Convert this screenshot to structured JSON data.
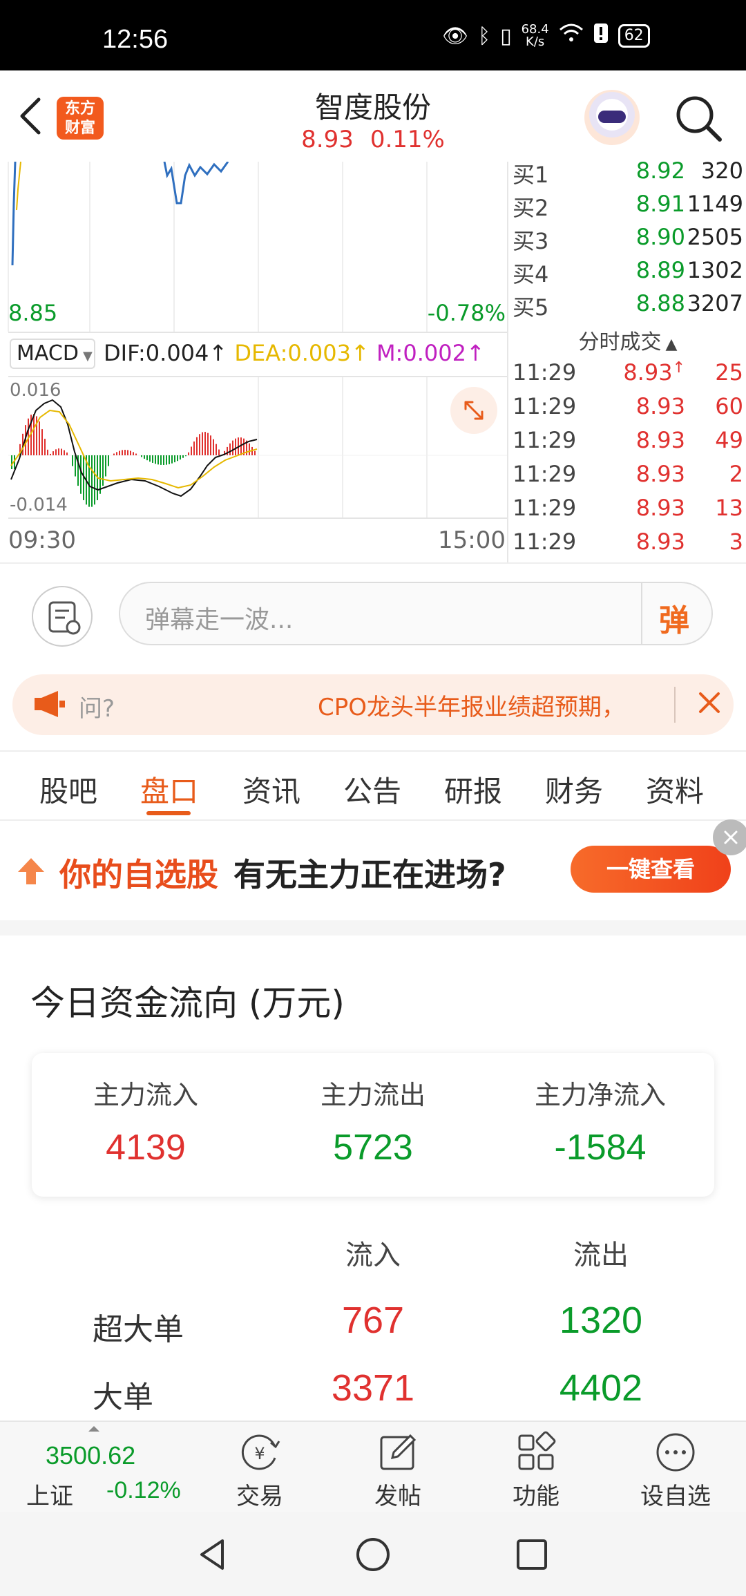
{
  "status_bar": {
    "time": "12:56",
    "net_speed_value": "68.4",
    "net_speed_unit": "K/s",
    "battery": "62",
    "icons": [
      "eye-icon",
      "bluetooth-icon",
      "vibrate-icon",
      "wifi-icon",
      "warning-icon",
      "battery-icon"
    ]
  },
  "header": {
    "logo_line1": "东方",
    "logo_line2": "财富",
    "title": "智度股份",
    "price": "8.93",
    "change_pct": "0.11%"
  },
  "chart": {
    "price_low_label": "8.85",
    "pct_low_label": "-0.78%",
    "indicator": "MACD",
    "dif": "DIF:0.004",
    "dea": "DEA:0.003",
    "m": "M:0.002",
    "macd_top": "0.016",
    "macd_bottom": "-0.014",
    "time_start": "09:30",
    "time_end": "15:00"
  },
  "order_book": {
    "bids": [
      {
        "label": "买1",
        "price": "8.92",
        "volume": "320"
      },
      {
        "label": "买2",
        "price": "8.91",
        "volume": "1149"
      },
      {
        "label": "买3",
        "price": "8.90",
        "volume": "2505"
      },
      {
        "label": "买4",
        "price": "8.89",
        "volume": "1302"
      },
      {
        "label": "买5",
        "price": "8.88",
        "volume": "3207"
      }
    ],
    "ticks_title": "分时成交",
    "ticks": [
      {
        "time": "11:29",
        "price": "8.93",
        "arrow": "↑",
        "volume": "25"
      },
      {
        "time": "11:29",
        "price": "8.93",
        "arrow": "",
        "volume": "60"
      },
      {
        "time": "11:29",
        "price": "8.93",
        "arrow": "",
        "volume": "49"
      },
      {
        "time": "11:29",
        "price": "8.93",
        "arrow": "",
        "volume": "2"
      },
      {
        "time": "11:29",
        "price": "8.93",
        "arrow": "",
        "volume": "13"
      },
      {
        "time": "11:29",
        "price": "8.93",
        "arrow": "",
        "volume": "3"
      }
    ]
  },
  "comment": {
    "placeholder": "弹幕走一波...",
    "danmu_label": "弹"
  },
  "news": {
    "question": "问?",
    "headline": "CPO龙头半年报业绩超预期，"
  },
  "tabs": [
    "股吧",
    "盘口",
    "资讯",
    "公告",
    "研报",
    "财务",
    "资料"
  ],
  "active_tab": "盘口",
  "promo": {
    "highlight": "你的自选股",
    "text": "有无主力正在进场?",
    "button": "一键查看"
  },
  "fund_flow": {
    "title": "今日资金流向 (万元)",
    "summary": [
      {
        "label": "主力流入",
        "value": "4139",
        "color": "#e0312f"
      },
      {
        "label": "主力流出",
        "value": "5723",
        "color": "#0a9b2a"
      },
      {
        "label": "主力净流入",
        "value": "-1584",
        "color": "#0a9b2a"
      }
    ],
    "col_in": "流入",
    "col_out": "流出",
    "rows": [
      {
        "label": "超大单",
        "in": "767",
        "out": "1320"
      },
      {
        "label": "大单",
        "in": "3371",
        "out": "4402"
      }
    ]
  },
  "toolbar": {
    "index_value": "3500.62",
    "index_name": "上证",
    "index_change": "-0.12%",
    "items": [
      "交易",
      "发帖",
      "功能",
      "设自选"
    ]
  }
}
